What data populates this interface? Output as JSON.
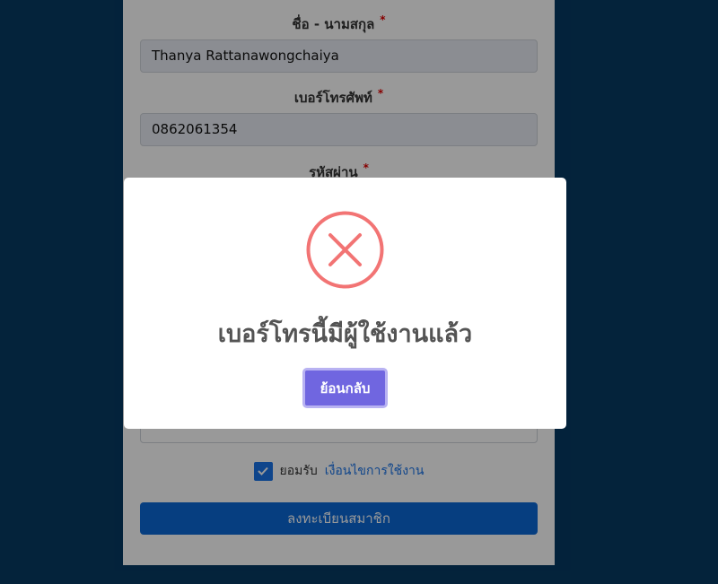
{
  "form": {
    "name_label": "ชื่อ - นามสกุล",
    "name_value": "Thanya Rattanawongchaiya",
    "phone_label": "เบอร์โทรศัพท์",
    "phone_value": "0862061354",
    "password_label": "รหัสผ่าน",
    "confirm_value": "•••••••",
    "required_mark": "*",
    "agree_text": "ยอมรับ",
    "terms_link": "เงื่อนไขการใช้งาน",
    "agree_checked": true,
    "submit_label": "ลงทะเบียนสมาชิก"
  },
  "dialog": {
    "icon": "error-x-icon",
    "title": "เบอร์โทรนี้มีผู้ใช้งานแล้ว",
    "button_label": "ย้อนกลับ",
    "icon_color": "#f27474",
    "button_color": "#7066e0"
  },
  "colors": {
    "page_bg": "#063a63",
    "primary": "#0a68d6"
  }
}
